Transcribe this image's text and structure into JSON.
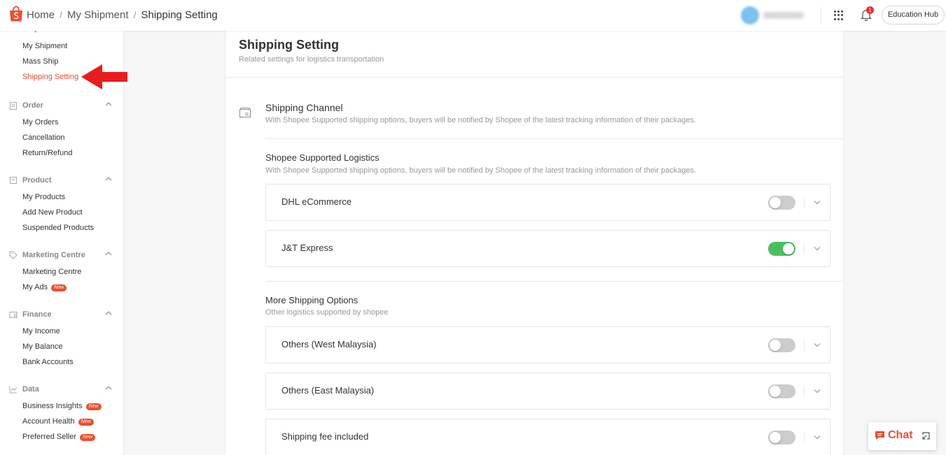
{
  "breadcrumb": {
    "home": "Home",
    "sep1": "/",
    "parent": "My Shipment",
    "sep2": "/",
    "current": "Shipping Setting"
  },
  "header": {
    "notification_count": "1",
    "education_hub": "Education Hub"
  },
  "sidebar": {
    "groups": [
      {
        "title": "Shipment",
        "icon": "truck-icon",
        "items": [
          {
            "label": "My Shipment"
          },
          {
            "label": "Mass Ship"
          },
          {
            "label": "Shipping Setting",
            "active": true
          }
        ]
      },
      {
        "title": "Order",
        "icon": "clipboard-icon",
        "items": [
          {
            "label": "My Orders"
          },
          {
            "label": "Cancellation"
          },
          {
            "label": "Return/Refund"
          }
        ]
      },
      {
        "title": "Product",
        "icon": "box-icon",
        "items": [
          {
            "label": "My Products"
          },
          {
            "label": "Add New Product"
          },
          {
            "label": "Suspended Products"
          }
        ]
      },
      {
        "title": "Marketing Centre",
        "icon": "tag-icon",
        "items": [
          {
            "label": "Marketing Centre"
          },
          {
            "label": "My Ads",
            "badge": "New"
          }
        ]
      },
      {
        "title": "Finance",
        "icon": "wallet-icon",
        "items": [
          {
            "label": "My Income"
          },
          {
            "label": "My Balance"
          },
          {
            "label": "Bank Accounts"
          }
        ]
      },
      {
        "title": "Data",
        "icon": "chart-icon",
        "items": [
          {
            "label": "Business Insights",
            "badge": "New"
          },
          {
            "label": "Account Health",
            "badge": "New"
          },
          {
            "label": "Preferred Seller",
            "badge": "New"
          }
        ]
      }
    ]
  },
  "page": {
    "title": "Shipping Setting",
    "subtitle": "Related settings for logistics transportation",
    "channel": {
      "title": "Shipping Channel",
      "desc": "With Shopee Supported shipping options, buyers will be notified by Shopee of the latest tracking information of their packages."
    },
    "supported": {
      "title": "Shopee Supported Logistics",
      "desc": "With Shopee Supported shipping options, buyers will be notified by Shopee of the latest tracking information of their packages.",
      "options": [
        {
          "name": "DHL eCommerce",
          "enabled": false
        },
        {
          "name": "J&T Express",
          "enabled": true
        }
      ]
    },
    "more": {
      "title": "More Shipping Options",
      "desc": "Other logistics supported by shopee",
      "options": [
        {
          "name": "Others (West Malaysia)",
          "enabled": false
        },
        {
          "name": "Others (East Malaysia)",
          "enabled": false
        },
        {
          "name": "Shipping fee included",
          "enabled": false
        }
      ]
    }
  },
  "chat": {
    "label": "Chat"
  },
  "colors": {
    "brand": "#ee4d2d",
    "toggle_on": "#48c060",
    "toggle_off": "#cccccc"
  }
}
